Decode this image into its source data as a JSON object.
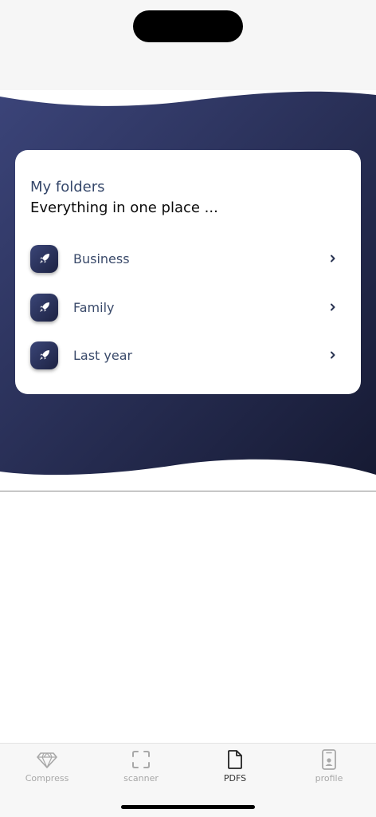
{
  "card": {
    "title": "My folders",
    "subtitle": "Everything in one place ..."
  },
  "folders": [
    {
      "label": "Business",
      "icon": "rocket-icon"
    },
    {
      "label": "Family",
      "icon": "rocket-icon"
    },
    {
      "label": "Last year",
      "icon": "rocket-icon"
    }
  ],
  "tabs": [
    {
      "label": "Compress",
      "icon": "diamond-icon",
      "active": false
    },
    {
      "label": "scanner",
      "icon": "scan-frame-icon",
      "active": false
    },
    {
      "label": "PDFS",
      "icon": "document-icon",
      "active": true
    },
    {
      "label": "profile",
      "icon": "id-badge-icon",
      "active": false
    }
  ],
  "colors": {
    "hero_gradient_start": "#3b4479",
    "hero_gradient_end": "#161a33",
    "title": "#35476a",
    "folder_label": "#3a4a6a",
    "tab_inactive": "#a8a8a8",
    "tab_active": "#333333"
  }
}
